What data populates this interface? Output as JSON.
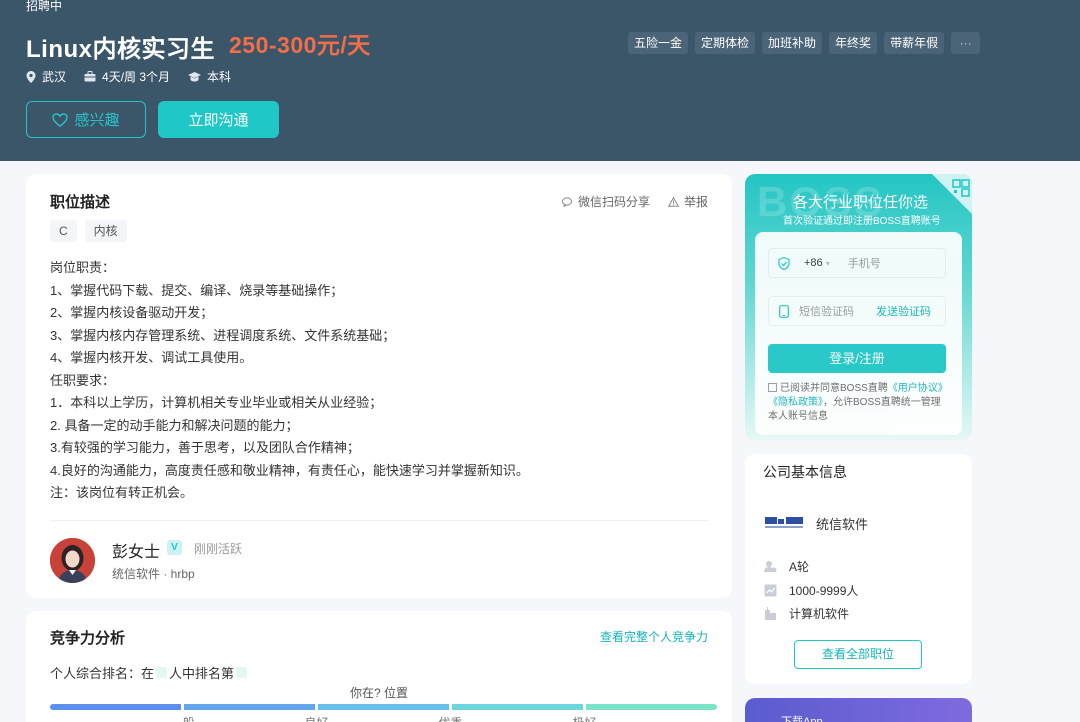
{
  "header": {
    "status": "招聘中",
    "title": "Linux内核实习生",
    "salary": "250-300元/天",
    "meta": {
      "city": "武汉",
      "schedule": "4天/周 3个月",
      "degree": "本科"
    },
    "interest_label": "感兴趣",
    "chat_label": "立即沟通",
    "benefits": [
      "五险一金",
      "定期体检",
      "加班补助",
      "年终奖",
      "带薪年假"
    ],
    "benefits_more": "···"
  },
  "job": {
    "section_title": "职位描述",
    "share_label": "微信扫码分享",
    "report_label": "举报",
    "tags": [
      "C",
      "内核"
    ],
    "description": [
      "岗位职责：",
      "1、掌握代码下载、提交、编译、烧录等基础操作；",
      "2、掌握内核设备驱动开发；",
      "3、掌握内核内存管理系统、进程调度系统、文件系统基础；",
      "4、掌握内核开发、调试工具使用。",
      "任职要求：",
      "1．本科以上学历，计算机相关专业毕业或相关从业经验；",
      "2. 具备一定的动手能力和解决问题的能力；",
      "3.有较强的学习能力，善于思考，以及团队合作精神；",
      "4.良好的沟通能力，高度责任感和敬业精神，有责任心，能快速学习并掌握新知识。",
      "注：该岗位有转正机会。"
    ],
    "recruiter": {
      "name": "彭女士",
      "badge": "V",
      "status": "刚刚活跃",
      "company_role": "统信软件 · hrbp"
    }
  },
  "competitiveness": {
    "title": "竞争力分析",
    "link": "查看完整个人竞争力",
    "rank_prefix": "个人综合排名：在",
    "rank_mid": "人中排名第",
    "position_label": "你在? 位置",
    "levels": [
      "一般",
      "良好",
      "优秀",
      "极好"
    ],
    "bar_colors": [
      "#5b8ff0",
      "#63a6ee",
      "#67c0ea",
      "#6dd6dd",
      "#79e4c6"
    ]
  },
  "login": {
    "watermark": "BOSS",
    "title": "各大行业职位任你选",
    "subtitle": "首次验证通过即注册BOSS直聘账号",
    "country_code": "+86",
    "phone_placeholder": "手机号",
    "code_placeholder": "短信验证码",
    "send_code": "发送验证码",
    "submit": "登录/注册",
    "agree_prefix": "已阅读并同意BOSS直聘",
    "agree_link1": "《用户协议》",
    "agree_link2": "《隐私政策》",
    "agree_suffix": "，允许BOSS直聘统一管理本人账号信息"
  },
  "company": {
    "section_title": "公司基本信息",
    "name": "统信软件",
    "funding": "A轮",
    "size": "1000-9999人",
    "industry": "计算机软件",
    "view_all": "查看全部职位"
  },
  "app": {
    "label": "下载App"
  }
}
